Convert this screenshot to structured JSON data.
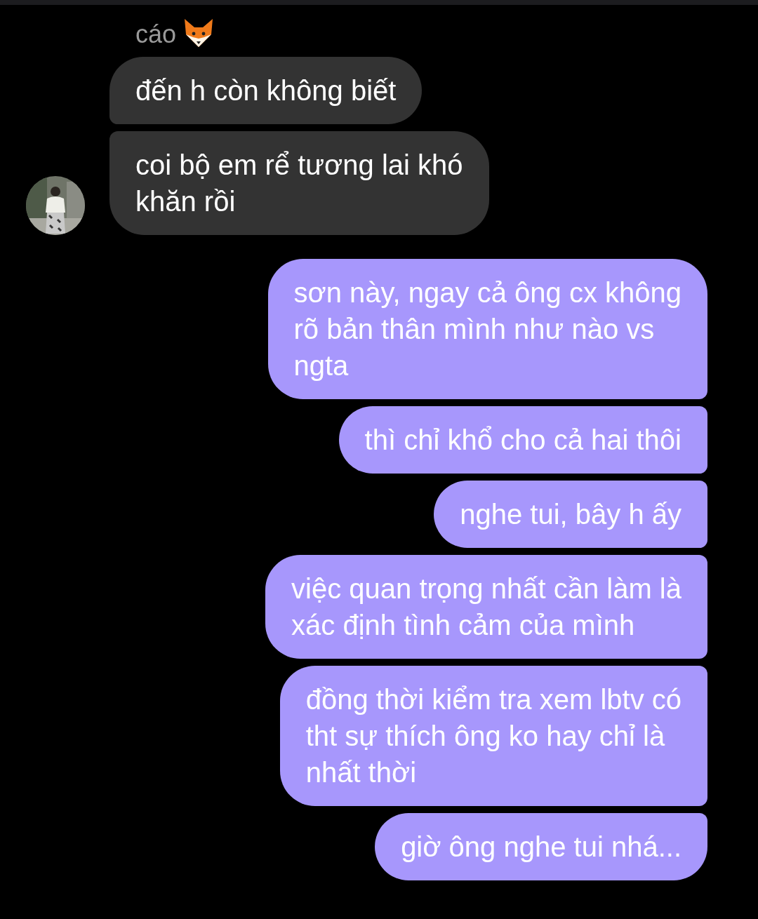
{
  "sender_name": "cáo",
  "messages": [
    {
      "kind": "received",
      "lines": [
        "đến h còn không biết"
      ]
    },
    {
      "kind": "received",
      "lines": [
        "coi bộ em rể tương lai khó",
        "khăn rồi"
      ]
    },
    {
      "kind": "sent",
      "lines": [
        "sơn này, ngay cả ông cx không",
        "rõ bản thân mình như nào vs",
        "ngta"
      ]
    },
    {
      "kind": "sent",
      "lines": [
        "thì chỉ khổ cho cả hai thôi"
      ]
    },
    {
      "kind": "sent",
      "lines": [
        "nghe tui, bây h ấy"
      ]
    },
    {
      "kind": "sent",
      "lines": [
        "việc quan trọng nhất cần làm là",
        "xác định tình cảm của mình"
      ]
    },
    {
      "kind": "sent",
      "lines": [
        "đồng thời kiểm tra xem lbtv có",
        "tht sự thích ông ko hay chỉ là",
        "nhất thời"
      ]
    },
    {
      "kind": "sent",
      "lines": [
        "giờ ông nghe tui nhá..."
      ]
    }
  ]
}
